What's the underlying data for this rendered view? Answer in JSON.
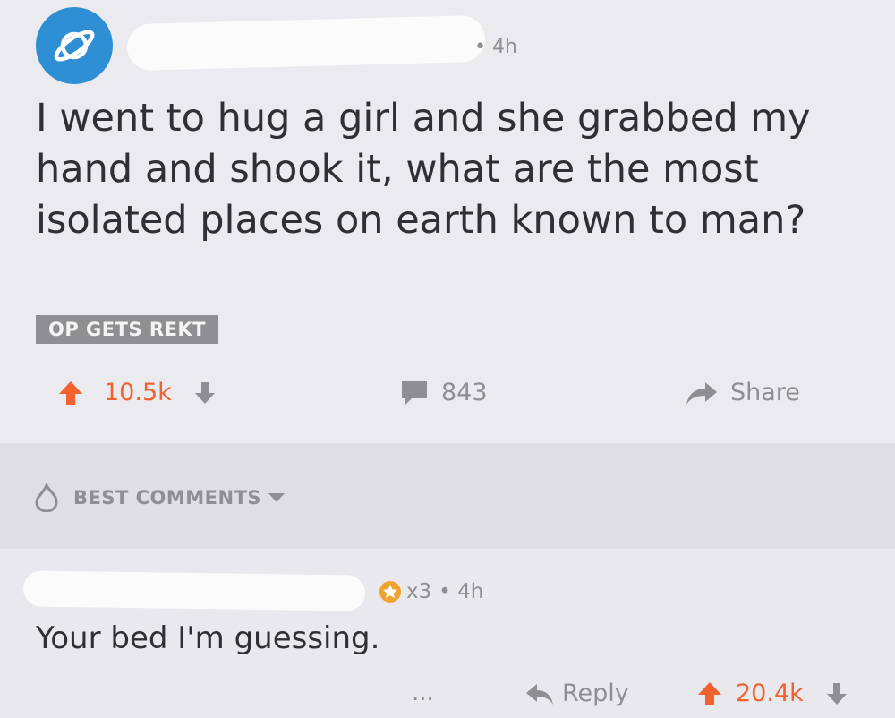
{
  "post": {
    "time": "• 4h",
    "title": "I went to hug a girl and she grabbed my hand and shook it, what are the most isolated places on earth known to man?",
    "flair": "OP GETS REKT",
    "upvotes": "10.5k",
    "comments": "843",
    "share_label": "Share"
  },
  "best_comments": {
    "label": "BEST COMMENTS"
  },
  "comment": {
    "badge_count": "x3",
    "time": "• 4h",
    "body": "Your bed I'm guessing.",
    "more": "...",
    "reply_label": "Reply",
    "upvotes": "20.4k"
  },
  "colors": {
    "accent": "#f2612e",
    "avatar": "#2f8fd4",
    "muted": "#8e8e93"
  }
}
